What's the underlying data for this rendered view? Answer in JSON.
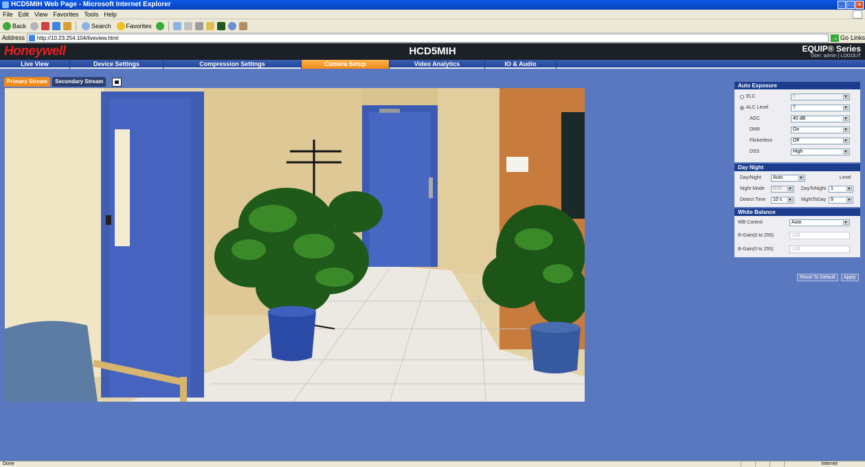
{
  "window": {
    "title": "HCD5MIH Web Page - Microsoft Internet Explorer"
  },
  "menu": [
    "File",
    "Edit",
    "View",
    "Favorites",
    "Tools",
    "Help"
  ],
  "toolbar": {
    "back_label": "Back",
    "search_label": "Search",
    "favorites_label": "Favorites"
  },
  "address": {
    "label": "Address",
    "url": "http://10.23.254.104/liveview.html",
    "go_label": "Go",
    "links_label": "Links"
  },
  "app": {
    "brand": "Honeywell",
    "model": "HCD5MIH",
    "series": "EQUIP® Series",
    "user_info": "User: admin | LOGOUT",
    "nav": [
      {
        "label": "Live View"
      },
      {
        "label": "Device Settings"
      },
      {
        "label": "Compression Settings"
      },
      {
        "label": "Camera Setup",
        "active": true
      },
      {
        "label": "Video Analytics"
      },
      {
        "label": "IO & Audio"
      }
    ],
    "stream_tabs": {
      "primary": "Primary Stream",
      "secondary": "Secondary Stream"
    }
  },
  "panel": {
    "auto_exposure": {
      "title": "Auto Exposure",
      "elc_label": "ELC",
      "elc_value": "5",
      "alc_label": "ALC Level",
      "alc_value": "7",
      "agc_label": "AGC",
      "agc_value": "40 dB",
      "dnr_label": "DNR",
      "dnr_value": "On",
      "flickerless_label": "Flickerless",
      "flickerless_value": "Off",
      "dss_label": "DSS",
      "dss_value": "High"
    },
    "day_night": {
      "title": "Day Night",
      "daynight_label": "Day/Night",
      "daynight_value": "Auto",
      "level_label": "Level",
      "night_mode_label": "Night Mode",
      "night_mode_value": "B/W",
      "day_to_night_label": "DayToNight",
      "day_to_night_value": "1",
      "detect_time_label": "Detect Time",
      "detect_time_value": "10 s",
      "night_to_day_label": "NightToDay",
      "night_to_day_value": "9"
    },
    "white_balance": {
      "title": "White Balance",
      "wb_label": "WB Control",
      "wb_value": "Auto",
      "rgain_label": "R-Gain(0 to 255)",
      "rgain_value": "120",
      "bgain_label": "B-Gain(0 to 255)",
      "bgain_value": "120"
    },
    "reset_label": "Reset To Default",
    "apply_label": "Apply"
  },
  "status": {
    "left": "Done",
    "zone": "Internet"
  },
  "colors": {
    "page_bg": "#5a78c0",
    "nav_active": "#f08a18",
    "brand_red": "#e41f1f",
    "section_head": "#1c3d8e"
  }
}
